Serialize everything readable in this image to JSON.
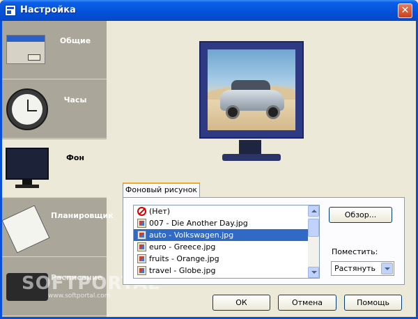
{
  "window": {
    "title": "Настройка",
    "close_glyph": "✕"
  },
  "sidebar": {
    "items": [
      {
        "label": "Общие",
        "icon": "window-icon"
      },
      {
        "label": "Часы",
        "icon": "clock-icon"
      },
      {
        "label": "Фон",
        "icon": "monitor-icon",
        "active": true
      },
      {
        "label": "Планировщик",
        "icon": "planner-icon"
      },
      {
        "label": "Расписание",
        "icon": "briefcase-icon"
      }
    ]
  },
  "background": {
    "tab_label": "Фоновый рисунок",
    "list": [
      {
        "label": "(Нет)",
        "icon": "none-icon",
        "selected": false
      },
      {
        "label": "007 - Die Another Day.jpg",
        "icon": "image-file-icon",
        "selected": false
      },
      {
        "label": "auto - Volkswagen.jpg",
        "icon": "image-file-icon",
        "selected": true
      },
      {
        "label": "euro - Greece.jpg",
        "icon": "image-file-icon",
        "selected": false
      },
      {
        "label": "fruits - Orange.jpg",
        "icon": "image-file-icon",
        "selected": false
      },
      {
        "label": "travel - Globe.jpg",
        "icon": "image-file-icon",
        "selected": false
      }
    ],
    "browse_label": "Обзор...",
    "place_label": "Поместить:",
    "place_value": "Растянуть"
  },
  "footer": {
    "ok_label": "ОК",
    "cancel_label": "Отмена",
    "help_label": "Помощь"
  },
  "watermark": {
    "logo": "SOFTPORTAL",
    "url": "www.softportal.com"
  }
}
